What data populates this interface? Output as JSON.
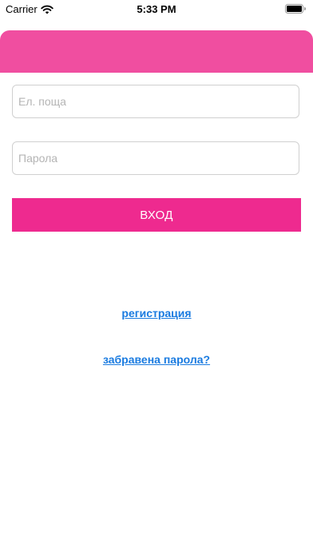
{
  "status_bar": {
    "carrier": "Carrier",
    "time": "5:33 PM",
    "icons": [
      "wifi-icon",
      "battery-icon"
    ]
  },
  "colors": {
    "header": "#f04ea0",
    "button": "#ee2a8f",
    "link": "#1a7be0"
  },
  "form": {
    "email_placeholder": "Ел. поща",
    "password_placeholder": "Парола",
    "login_label": "ВХОД"
  },
  "links": {
    "register": "регистрация",
    "forgot_password": "забравена парола?"
  }
}
